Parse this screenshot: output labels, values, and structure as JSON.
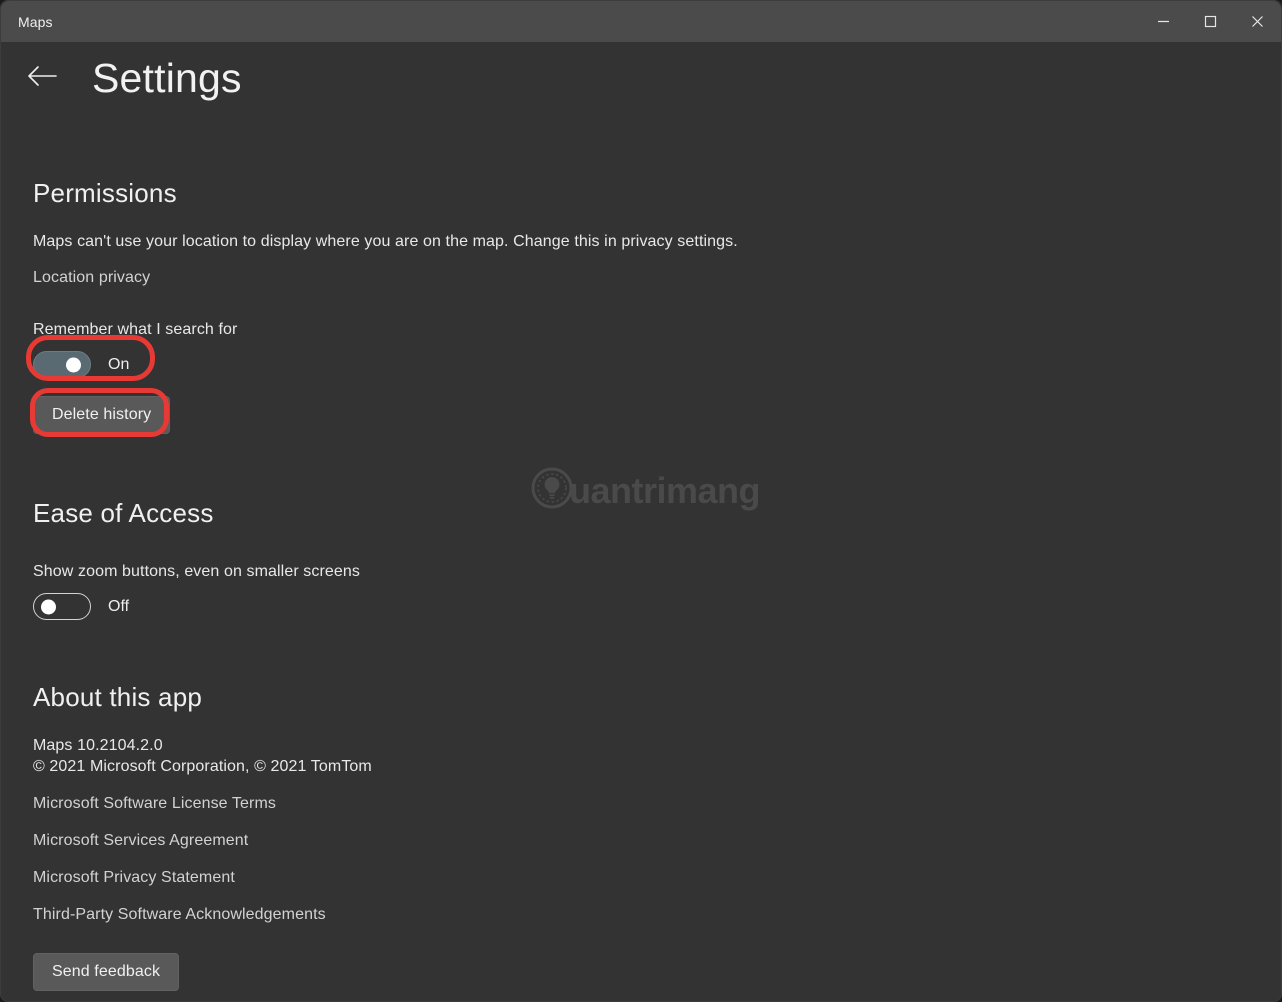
{
  "window": {
    "title": "Maps",
    "controls": {
      "minimize": "minimize-icon",
      "maximize": "maximize-icon",
      "close": "close-icon"
    }
  },
  "header": {
    "back_icon": "arrow-left-icon",
    "title": "Settings"
  },
  "sections": {
    "permissions": {
      "heading": "Permissions",
      "description": "Maps can't use your location to display where you are on the map. Change this in privacy settings.",
      "link": "Location privacy",
      "setting_label": "Remember what I search for",
      "toggle_state": "On",
      "delete_button": "Delete history"
    },
    "ease_of_access": {
      "heading": "Ease of Access",
      "setting_label": "Show zoom buttons, even on smaller screens",
      "toggle_state": "Off"
    },
    "about": {
      "heading": "About this app",
      "version": "Maps 10.2104.2.0",
      "copyright": "© 2021 Microsoft Corporation, © 2021 TomTom",
      "links": [
        "Microsoft Software License Terms",
        "Microsoft Services Agreement",
        "Microsoft Privacy Statement",
        "Third-Party Software Acknowledgements"
      ],
      "feedback_button": "Send feedback"
    }
  },
  "watermark": {
    "text": "uantrimang",
    "logo_icon": "lightbulb-gear-logo"
  },
  "colors": {
    "window_background": "#333333",
    "titlebar_background": "#4b4b4b",
    "toggle_on": "#596a73",
    "button_background": "#595959",
    "highlight_red": "#e83a34",
    "text_primary": "#f0f0f0",
    "link_text": "#d2d2d2",
    "watermark": "#4a4a4a"
  }
}
